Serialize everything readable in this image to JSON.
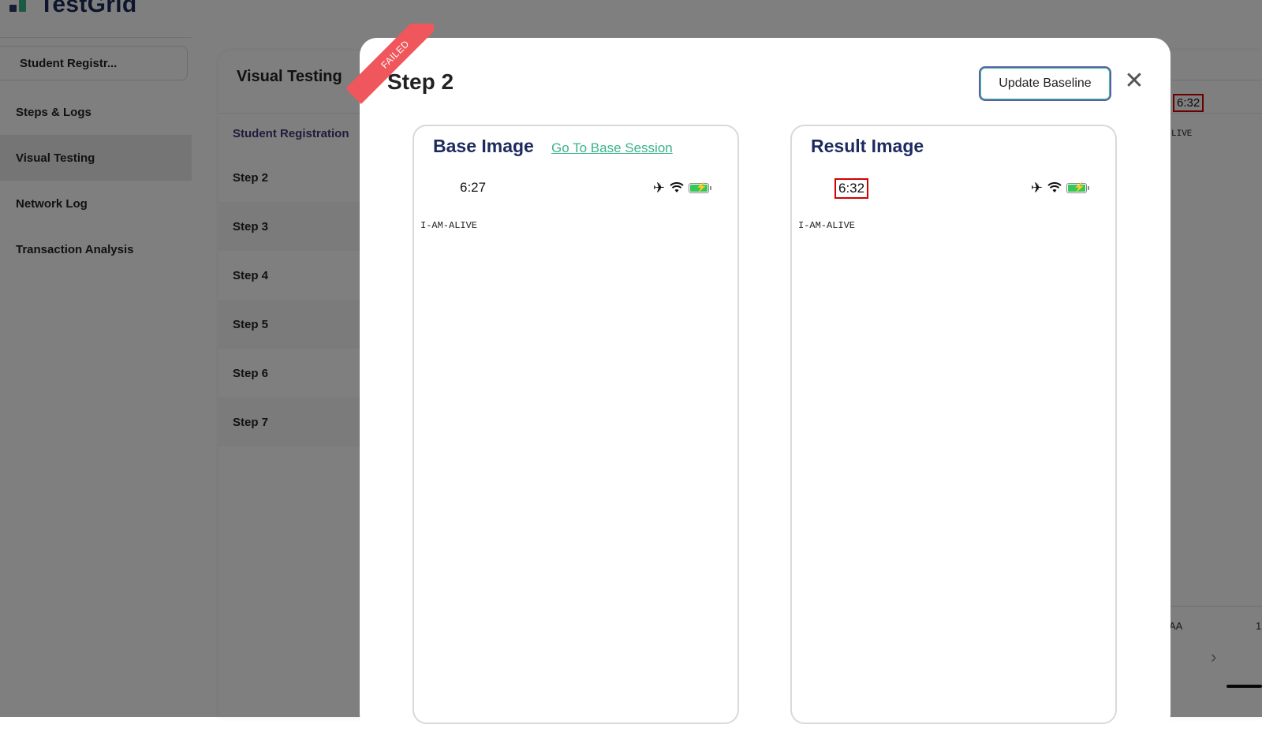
{
  "app": {
    "brand": "TestGrid",
    "session_name": "Student Registr...",
    "side_nav": [
      "Steps & Logs",
      "Visual Testing",
      "Network Log",
      "Transaction Analysis"
    ],
    "active_nav": "Visual Testing"
  },
  "visual_testing": {
    "title": "Visual Testing",
    "list_header": "Student Registration",
    "steps": [
      "Step 2",
      "Step 3",
      "Step 4",
      "Step 5",
      "Step 6",
      "Step 7"
    ],
    "background_preview": {
      "time": "6:32",
      "text": "LIVE",
      "footer_label": "AA",
      "footer_value": "1"
    }
  },
  "modal": {
    "status_ribbon": "FAILED",
    "title": "Step 2",
    "update_button": "Update Baseline",
    "close_icon": "close-icon",
    "base": {
      "title": "Base Image",
      "link": "Go To Base Session",
      "time": "6:27",
      "body_text": "I-AM-ALIVE"
    },
    "result": {
      "title": "Result Image",
      "time": "6:32",
      "body_text": "I-AM-ALIVE"
    },
    "status_icons": [
      "airplane-icon",
      "wifi-icon",
      "battery-charging-icon"
    ],
    "colors": {
      "ribbon": "#f0575c",
      "diff_highlight": "#d40000",
      "title_navy": "#1d2a5e",
      "link_green": "#3bb38a",
      "battery_green": "#35c759"
    }
  }
}
